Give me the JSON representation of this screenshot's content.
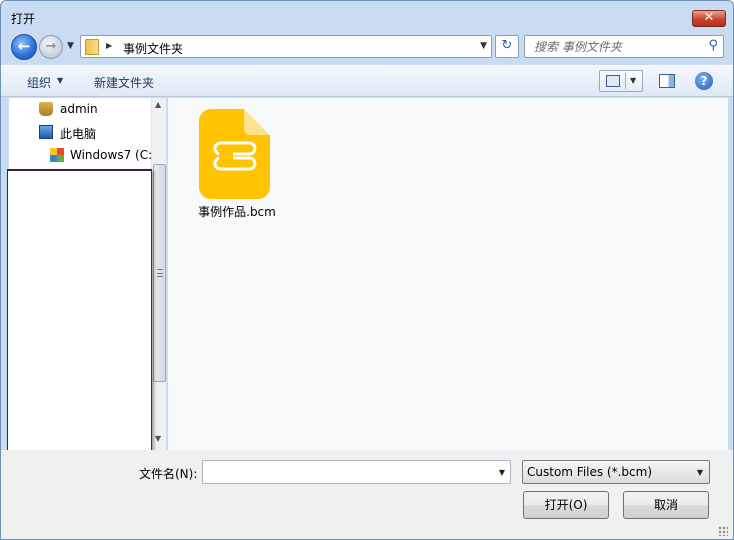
{
  "window": {
    "title": "打开",
    "close_glyph": "✕"
  },
  "nav": {
    "back_glyph": "←",
    "forward_glyph": "→",
    "address_path": "事例文件夹",
    "refresh_glyph": "↻",
    "search_placeholder": "搜索 事例文件夹"
  },
  "toolbar": {
    "organize_label": "组织",
    "new_folder_label": "新建文件夹",
    "help_glyph": "?"
  },
  "sidebar": {
    "items": [
      {
        "label": "admin",
        "icon": "user-folder-icon"
      },
      {
        "label": "此电脑",
        "icon": "computer-icon"
      },
      {
        "label": "Windows7 (C:",
        "icon": "windows-drive-icon"
      }
    ]
  },
  "files": [
    {
      "name": "事例作品.bcm",
      "icon": "bcm-file-icon",
      "color": "#FFC300"
    }
  ],
  "footer": {
    "filename_label": "文件名(N):",
    "filename_value": "",
    "filetype_selected": "Custom Files (*.bcm)",
    "open_label": "打开(O)",
    "cancel_label": "取消"
  }
}
